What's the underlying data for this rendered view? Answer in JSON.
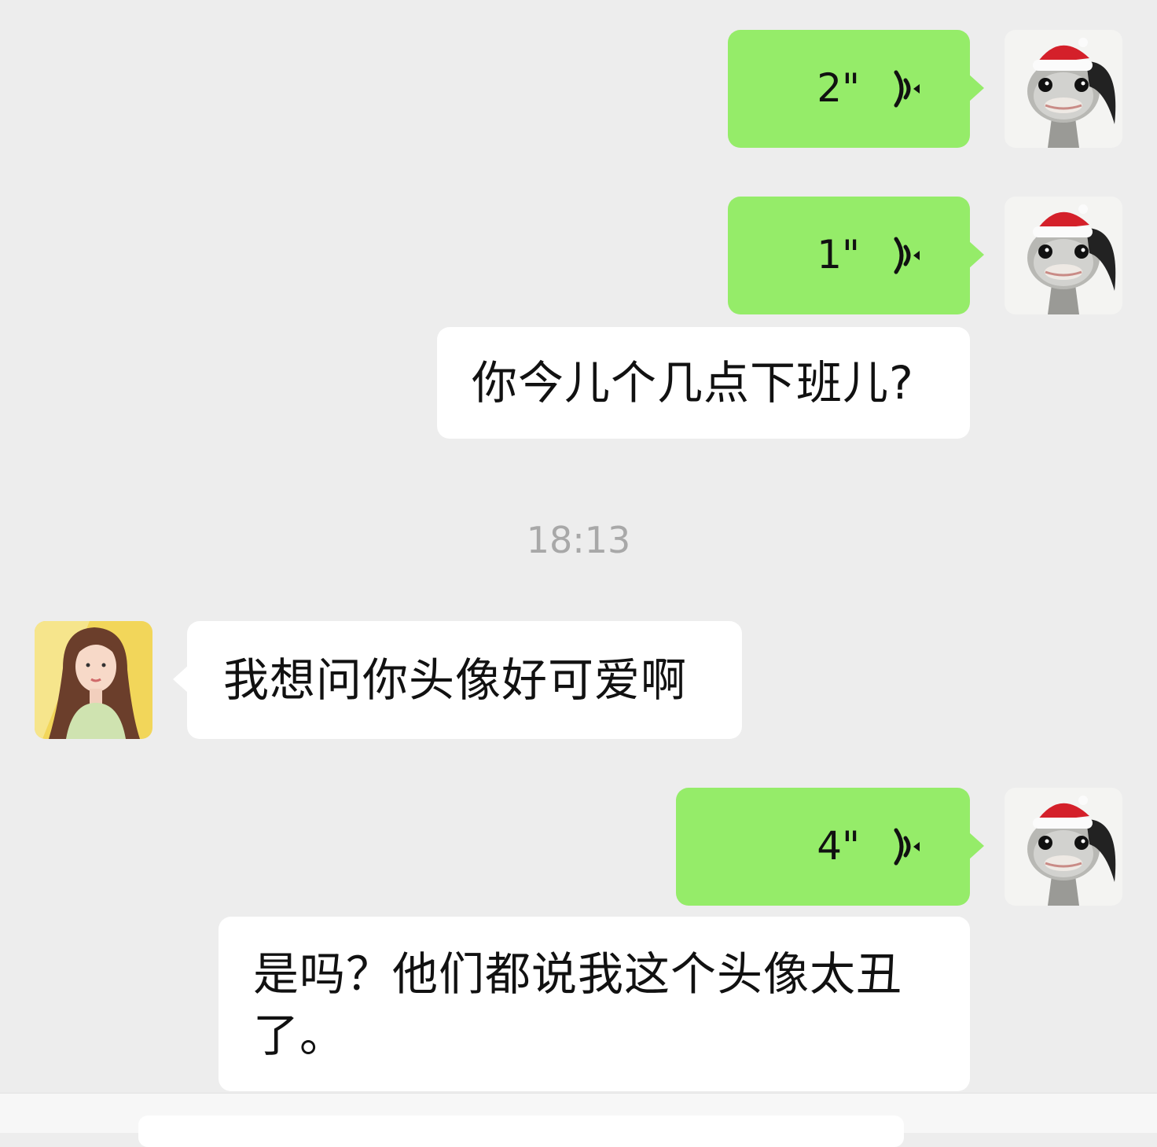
{
  "chat": {
    "messages": [
      {
        "id": "m1",
        "type": "voice",
        "side": "right",
        "duration": "2\""
      },
      {
        "id": "m2",
        "type": "voice",
        "side": "right",
        "duration": "1\""
      },
      {
        "id": "m3",
        "type": "text",
        "side": "right",
        "text": "你今儿个几点下班儿?"
      },
      {
        "id": "m4",
        "type": "timestamp",
        "text": "18:13"
      },
      {
        "id": "m5",
        "type": "text",
        "side": "left",
        "text": "我想问你头像好可爱啊"
      },
      {
        "id": "m6",
        "type": "voice",
        "side": "right",
        "duration": "4\""
      },
      {
        "id": "m7",
        "type": "text",
        "side": "right",
        "text": "是吗？他们都说我这个头像太丑\n了。"
      }
    ]
  },
  "avatars": {
    "self": "ostrich-santa-hat-avatar",
    "contact": "long-hair-woman-avatar"
  },
  "colors": {
    "background": "#ededed",
    "self_bubble": "#95ec69",
    "other_bubble": "#ffffff",
    "timestamp": "#a8a8a8"
  },
  "icons": {
    "voice": "voice-wave-icon"
  }
}
